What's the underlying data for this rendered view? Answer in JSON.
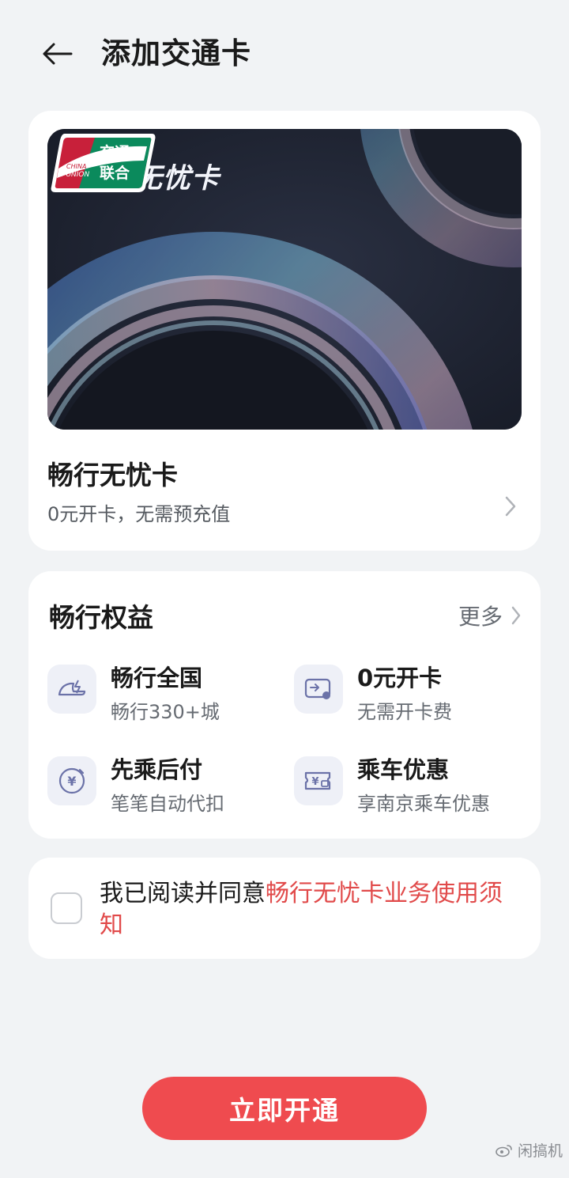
{
  "header": {
    "title": "添加交通卡"
  },
  "card": {
    "image_title": "畅行无忧卡",
    "name": "畅行无忧卡",
    "subtitle": "0元开卡，无需预充值",
    "logo": {
      "text_cn": "交通联合",
      "text_en": "CHINA T-UNION"
    }
  },
  "benefits": {
    "title": "畅行权益",
    "more_label": "更多",
    "items": [
      {
        "icon": "train-speed-icon",
        "title": "畅行全国",
        "desc": "畅行330+城"
      },
      {
        "icon": "card-icon",
        "title": "0元开卡",
        "desc": "无需开卡费"
      },
      {
        "icon": "yuan-ride-icon",
        "title": "先乘后付",
        "desc": "笔笔自动代扣"
      },
      {
        "icon": "coupon-icon",
        "title": "乘车优惠",
        "desc": "享南京乘车优惠"
      }
    ]
  },
  "agreement": {
    "prefix": "我已阅读并同意",
    "link": "畅行无忧卡业务使用须知",
    "checked": false
  },
  "cta": {
    "label": "立即开通"
  },
  "watermark": {
    "text": "闲搞机"
  },
  "colors": {
    "accent": "#ef4b4f",
    "link": "#e14a4a",
    "background": "#f1f3f5"
  }
}
